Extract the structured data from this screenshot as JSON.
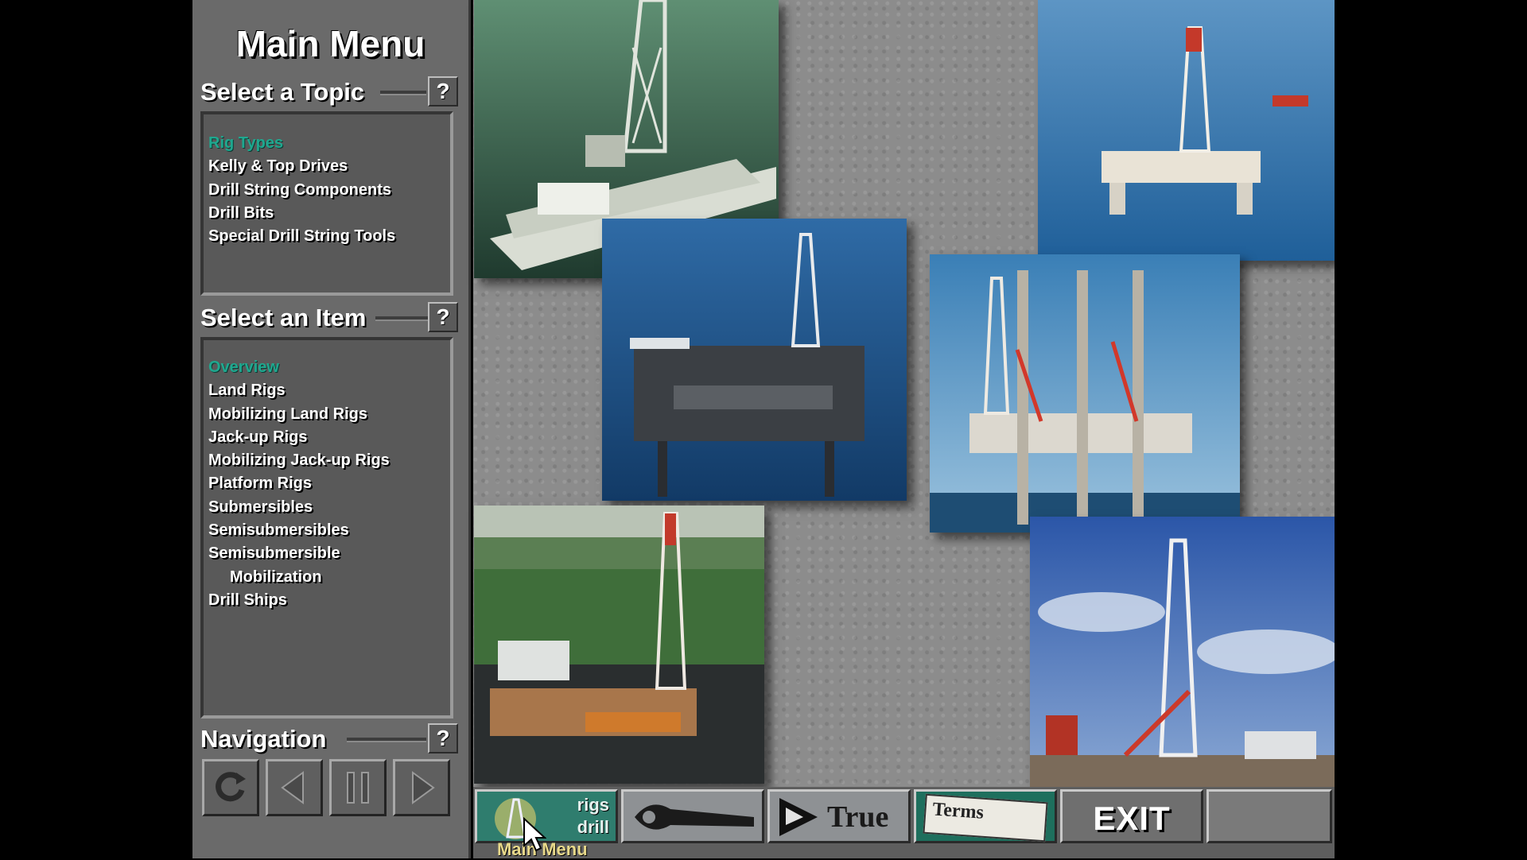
{
  "main_menu": {
    "title": "Main Menu"
  },
  "topic_section": {
    "label": "Select a Topic",
    "help": "?",
    "items": [
      {
        "label": "Rig Types",
        "active": true
      },
      {
        "label": "Kelly & Top Drives"
      },
      {
        "label": "Drill String Components"
      },
      {
        "label": "Drill Bits"
      },
      {
        "label": "Special Drill String Tools"
      }
    ]
  },
  "item_section": {
    "label": "Select an Item",
    "help": "?",
    "items": [
      {
        "label": "Overview",
        "active": true
      },
      {
        "label": "Land Rigs"
      },
      {
        "label": "Mobilizing Land Rigs"
      },
      {
        "label": "Jack-up Rigs"
      },
      {
        "label": "Mobilizing Jack-up Rigs"
      },
      {
        "label": "Platform Rigs"
      },
      {
        "label": "Submersibles"
      },
      {
        "label": "Semisubmersibles"
      },
      {
        "label": "Semisubmersible"
      },
      {
        "label": "Mobilization",
        "indent": true
      },
      {
        "label": "Drill Ships"
      }
    ]
  },
  "navigation": {
    "label": "Navigation",
    "help": "?",
    "buttons": [
      "replay-icon",
      "previous-icon",
      "pause-icon",
      "next-icon"
    ]
  },
  "bottom_bar": {
    "rigs_text": "rigs",
    "drill_text": "drill",
    "true_text": "True",
    "terms_text": "Terms",
    "exit_label": "EXIT",
    "caption": "Main Menu"
  }
}
